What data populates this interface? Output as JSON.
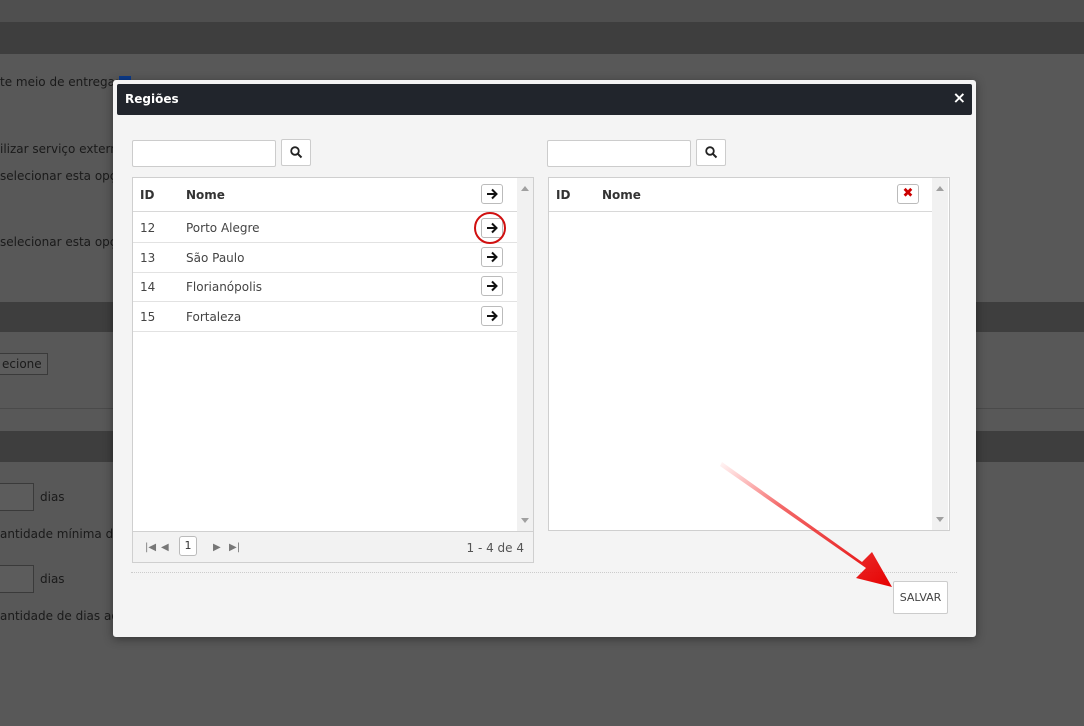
{
  "background": {
    "delivery_label": "te meio de entrega:",
    "external_service_text": "ilizar serviço externo",
    "select_option_text_1": "selecionar esta opçã",
    "select_option_text_2": "selecionar esta opçã",
    "select_button": "ecione",
    "days_label_1": "dias",
    "min_quantity_text": "antidade mínima de",
    "days_label_2": "dias",
    "additional_days_text": "antidade de dias adic"
  },
  "modal": {
    "title": "Regiões",
    "close_glyph": "×",
    "left_search": {
      "value": "",
      "placeholder": ""
    },
    "right_search": {
      "value": "",
      "placeholder": ""
    },
    "left_grid": {
      "columns": [
        "ID",
        "Nome"
      ],
      "rows": [
        {
          "id": "12",
          "name": "Porto Alegre"
        },
        {
          "id": "13",
          "name": "São Paulo"
        },
        {
          "id": "14",
          "name": "Florianópolis"
        },
        {
          "id": "15",
          "name": "Fortaleza"
        }
      ],
      "pager": {
        "current_page": "1",
        "info": "1 - 4 de 4"
      }
    },
    "right_grid": {
      "columns": [
        "ID",
        "Nome"
      ],
      "remove_glyph": "✖"
    },
    "save_label": "SALVAR"
  },
  "colors": {
    "header_bg": "#21252c",
    "annotation_red": "#d01010"
  }
}
